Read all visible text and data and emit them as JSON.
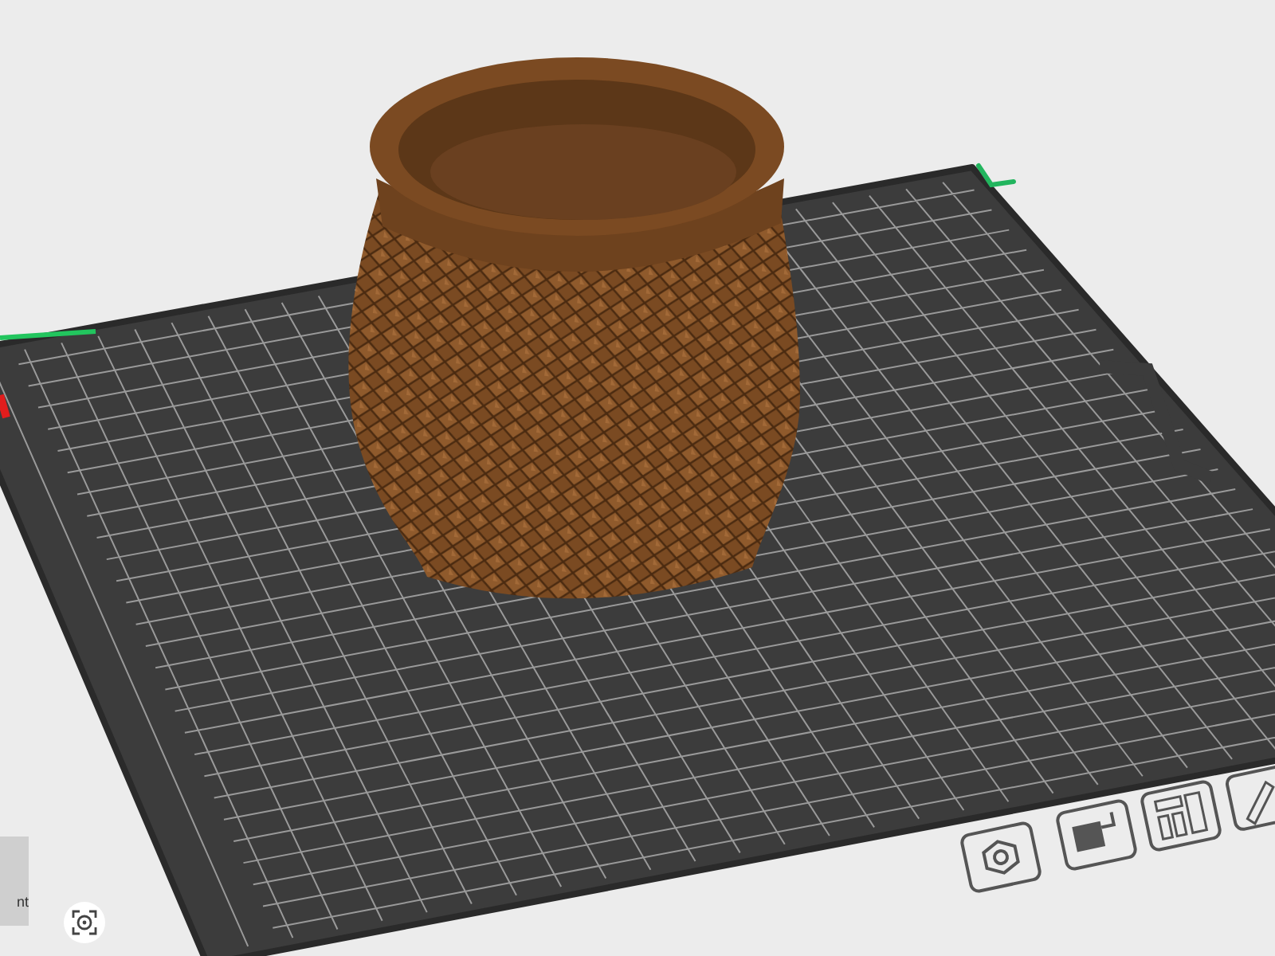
{
  "view_cube": {
    "label": "nt"
  }
}
